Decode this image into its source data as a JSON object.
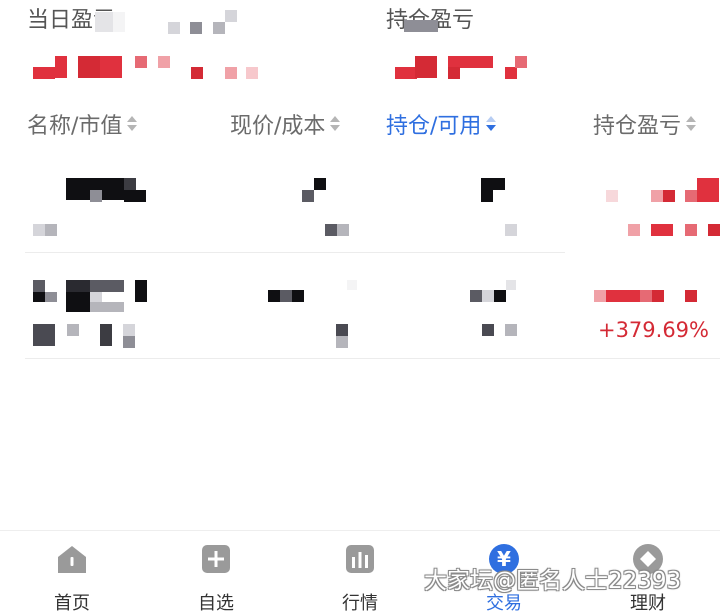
{
  "summary": {
    "daily_pl_label": "当日盈亏",
    "position_pl_label": "持仓盈亏"
  },
  "columns": [
    {
      "label": "名称/市值",
      "sorted": false
    },
    {
      "label": "现价/成本",
      "sorted": false
    },
    {
      "label": "持仓/可用",
      "sorted": true
    },
    {
      "label": "持仓盈亏",
      "sorted": false
    }
  ],
  "holdings": [
    {
      "pl_percent": ""
    },
    {
      "pl_percent": "+379.69%"
    }
  ],
  "tabbar": {
    "tabs": [
      {
        "label": "首页",
        "icon": "home-icon",
        "active": false
      },
      {
        "label": "自选",
        "icon": "plus-box-icon",
        "active": false
      },
      {
        "label": "行情",
        "icon": "bar-chart-icon",
        "active": false
      },
      {
        "label": "交易",
        "icon": "yen-icon",
        "active": true
      },
      {
        "label": "理财",
        "icon": "coin-icon",
        "active": false
      }
    ]
  },
  "watermark": "大家坛@匿名人士22393",
  "colors": {
    "accent": "#2f6fe0",
    "gain": "#d42a35",
    "text": "#333333",
    "muted": "#6b6b6b"
  }
}
